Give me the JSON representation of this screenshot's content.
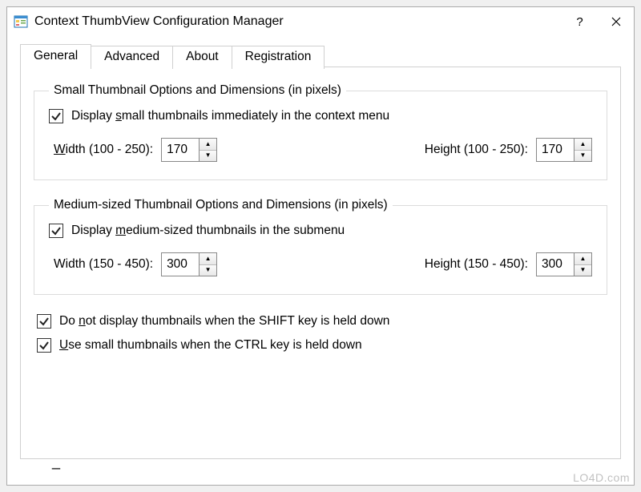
{
  "window": {
    "title": "Context ThumbView Configuration Manager"
  },
  "tabs": {
    "general": "General",
    "advanced": "Advanced",
    "about": "About",
    "registration": "Registration"
  },
  "smallGroup": {
    "legend": "Small Thumbnail Options and Dimensions (in pixels)",
    "checkbox_pre": "Display ",
    "checkbox_u": "s",
    "checkbox_post": "mall thumbnails immediately in the context menu",
    "width_label_u": "W",
    "width_label_post": "idth  (100 - 250):",
    "width_value": "170",
    "height_label": "Height  (100 - 250):",
    "height_value": "170"
  },
  "mediumGroup": {
    "legend": "Medium-sized Thumbnail Options and Dimensions (in pixels)",
    "checkbox_pre": "Display ",
    "checkbox_u": "m",
    "checkbox_post": "edium-sized thumbnails in the submenu",
    "width_label": "Width  (150 - 450):",
    "width_value": "300",
    "height_label": "Height  (150 - 450):",
    "height_value": "300"
  },
  "extra": {
    "shift_pre": "Do ",
    "shift_u": "n",
    "shift_post": "ot display thumbnails when the SHIFT key is held down",
    "ctrl_u": "U",
    "ctrl_post": "se small thumbnails when the CTRL key is held down"
  },
  "watermark": "LO4D.com"
}
